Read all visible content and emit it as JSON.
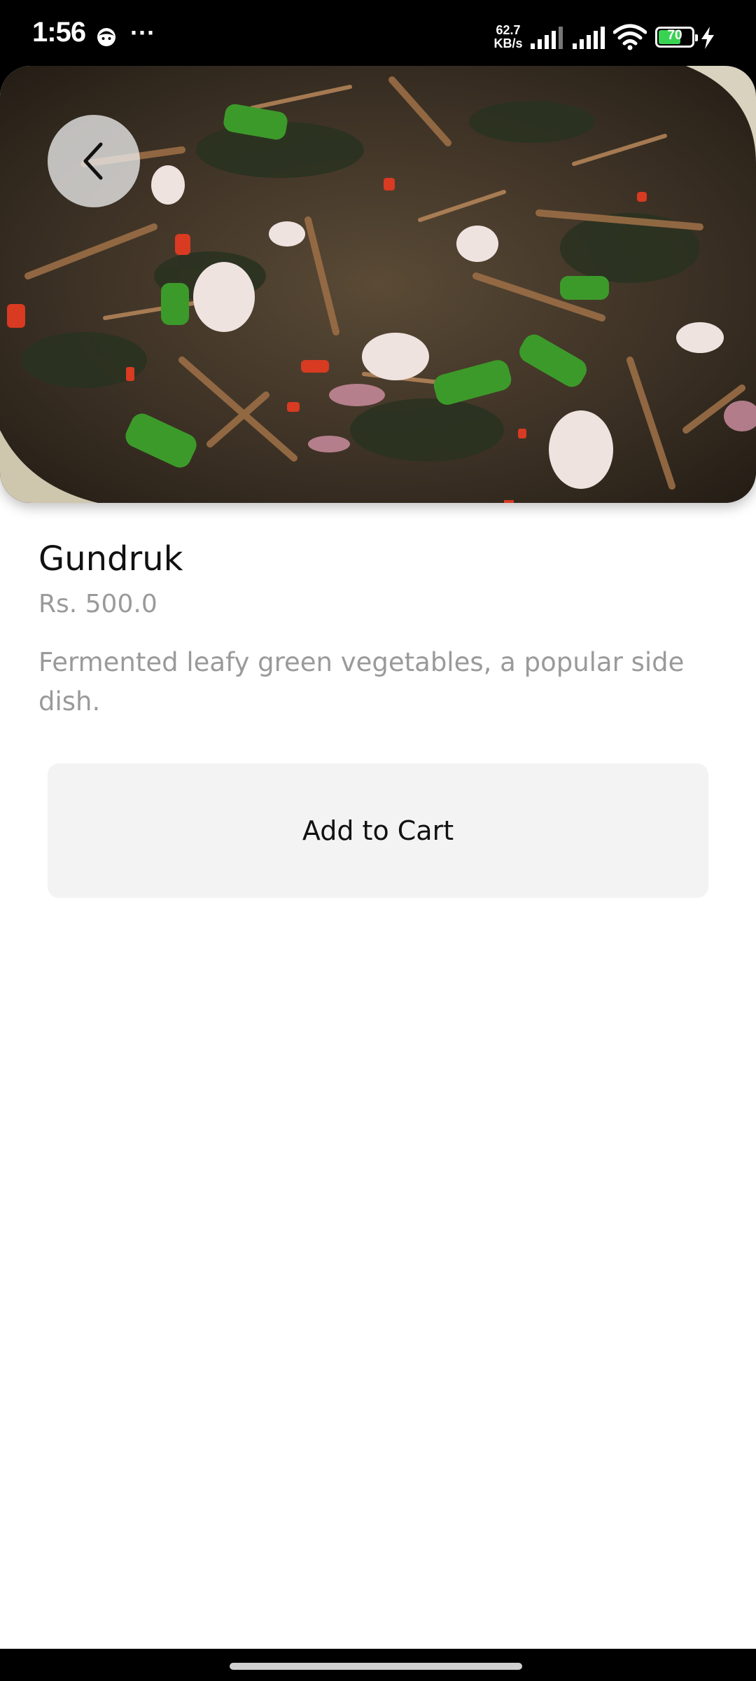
{
  "status_bar": {
    "time": "1:56",
    "more": "···",
    "speed_value": "62.7",
    "speed_unit": "KB/s",
    "battery_level": "70",
    "battery_color": "#39d353",
    "icons": [
      "face-icon",
      "signal-icon",
      "signal-icon",
      "wifi-icon",
      "battery-icon",
      "charging-icon"
    ]
  },
  "product": {
    "image_icon": "food-photo",
    "back_icon": "chevron-left-icon",
    "name": "Gundruk",
    "price": "Rs. 500.0",
    "description": "Fermented leafy green vegetables, a popular side dish.",
    "add_to_cart_label": "Add to Cart"
  },
  "colors": {
    "background": "#ffffff",
    "muted_text": "#9a9a9a",
    "button_bg": "#f3f3f3"
  }
}
